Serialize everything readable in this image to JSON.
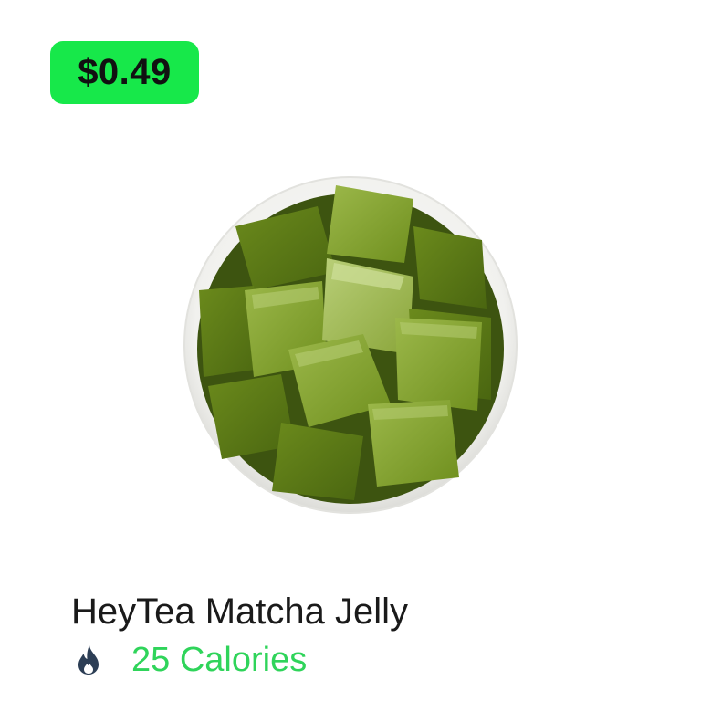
{
  "product": {
    "price": "$0.49",
    "name": "HeyTea Matcha Jelly",
    "calories": "25 Calories",
    "image_icon": "matcha-jelly-bowl-image",
    "calorie_icon": "flame-icon"
  },
  "colors": {
    "price_badge_bg": "#17e84a",
    "calorie_text": "#2fd45a",
    "flame": "#2c3e55",
    "jelly": "#6f8f1e",
    "bowl": "#f4f4f2"
  }
}
